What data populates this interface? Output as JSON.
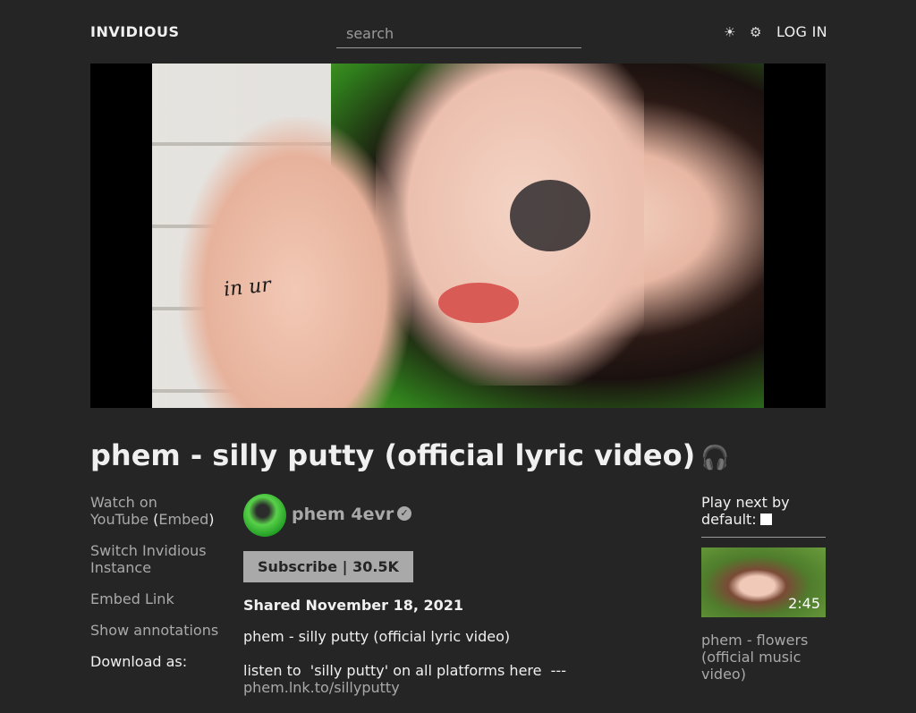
{
  "header": {
    "brand": "INVIDIOUS",
    "search_placeholder": "search",
    "theme_icons": [
      "☀",
      "⚙"
    ],
    "login": "LOG IN"
  },
  "video": {
    "title": "phem - silly putty (official lyric video)",
    "audio_icon": "🎧",
    "thumbnail_text": "in ur"
  },
  "left_links": {
    "watch_on": "Watch on",
    "youtube": "YouTube",
    "open_paren": " (",
    "embed": "Embed",
    "close_paren": ")",
    "switch_instance": "Switch Invidious Instance",
    "embed_link": "Embed Link",
    "show_annotations": "Show annotations",
    "download_as": "Download as:"
  },
  "channel": {
    "name": "phem 4evr",
    "verified_icon": "✓",
    "subscribe_label": "Subscribe | 30.5K"
  },
  "shared": "Shared November 18, 2021",
  "description": {
    "line1": "phem - silly putty (official lyric video)",
    "line2": "listen to  'silly putty' on all platforms here  ---",
    "line3_link": "phem.lnk.to/sillyputty"
  },
  "sidebar": {
    "play_next_label": "Play next by default:",
    "recommended": [
      {
        "title": "phem - flowers (official music video)",
        "duration": "2:45"
      }
    ]
  },
  "colors": {
    "background": "#252525",
    "text": "#f0f0f0",
    "muted": "#a9a9a9"
  }
}
